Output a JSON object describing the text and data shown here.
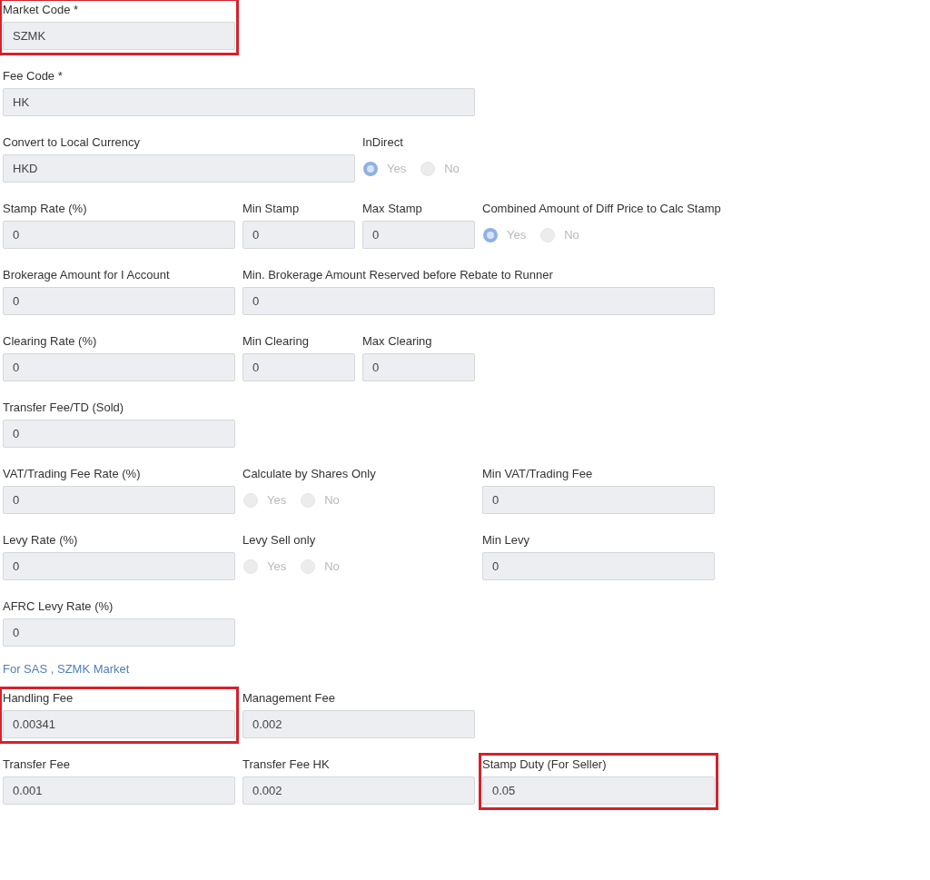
{
  "rows": [
    {
      "cells": [
        {
          "kind": "field",
          "label": "Market Code *",
          "value": "SZMK",
          "highlighted": true
        }
      ]
    },
    {
      "cells": [
        {
          "kind": "field",
          "label": "Fee Code *",
          "value": "HK"
        }
      ]
    },
    {
      "cells": [
        {
          "kind": "field",
          "label": "Convert to Local Currency",
          "value": "HKD"
        },
        {
          "kind": "radio",
          "label": "InDirect",
          "disabled": true,
          "options": [
            {
              "label": "Yes",
              "selected": true
            },
            {
              "label": "No",
              "selected": false
            }
          ]
        }
      ]
    },
    {
      "cells": [
        {
          "kind": "field",
          "label": "Stamp Rate (%)",
          "value": "0"
        },
        {
          "kind": "field",
          "label": "Min Stamp",
          "value": "0"
        },
        {
          "kind": "field",
          "label": "Max Stamp",
          "value": "0"
        },
        {
          "kind": "radio",
          "label": "Combined Amount of Diff Price to Calc Stamp",
          "disabled": true,
          "options": [
            {
              "label": "Yes",
              "selected": true
            },
            {
              "label": "No",
              "selected": false
            }
          ]
        }
      ]
    },
    {
      "cells": [
        {
          "kind": "field",
          "label": "Brokerage Amount for I Account",
          "value": "0"
        },
        {
          "kind": "field",
          "label": "Min. Brokerage Amount Reserved before Rebate to Runner",
          "value": "0"
        }
      ]
    },
    {
      "cells": [
        {
          "kind": "field",
          "label": "Clearing Rate (%)",
          "value": "0"
        },
        {
          "kind": "field",
          "label": "Min Clearing",
          "value": "0"
        },
        {
          "kind": "field",
          "label": "Max Clearing",
          "value": "0"
        }
      ]
    },
    {
      "cells": [
        {
          "kind": "field",
          "label": "Transfer Fee/TD (Sold)",
          "value": "0"
        }
      ]
    },
    {
      "cells": [
        {
          "kind": "field",
          "label": "VAT/Trading Fee Rate (%)",
          "value": "0"
        },
        {
          "kind": "radio",
          "label": "Calculate by Shares Only",
          "disabled": true,
          "options": [
            {
              "label": "Yes",
              "selected": false
            },
            {
              "label": "No",
              "selected": false
            }
          ]
        },
        {
          "kind": "field",
          "label": "Min VAT/Trading Fee",
          "value": "0"
        }
      ]
    },
    {
      "cells": [
        {
          "kind": "field",
          "label": "Levy Rate (%)",
          "value": "0"
        },
        {
          "kind": "radio",
          "label": "Levy Sell only",
          "disabled": true,
          "options": [
            {
              "label": "Yes",
              "selected": false
            },
            {
              "label": "No",
              "selected": false
            }
          ]
        },
        {
          "kind": "field",
          "label": "Min Levy",
          "value": "0"
        }
      ]
    },
    {
      "cells": [
        {
          "kind": "field",
          "label": "AFRC Levy Rate (%)",
          "value": "0"
        }
      ]
    },
    {
      "kind": "heading",
      "text": "For SAS , SZMK Market"
    },
    {
      "cells": [
        {
          "kind": "field",
          "label": "Handling Fee",
          "value": "0.00341",
          "highlighted": true
        },
        {
          "kind": "field",
          "label": "Management Fee",
          "value": "0.002"
        }
      ]
    },
    {
      "cells": [
        {
          "kind": "field",
          "label": "Transfer Fee",
          "value": "0.001"
        },
        {
          "kind": "field",
          "label": "Transfer Fee HK",
          "value": "0.002"
        },
        {
          "kind": "field",
          "label": "Stamp Duty (For Seller)",
          "value": "0.05",
          "highlighted": true
        }
      ]
    }
  ]
}
